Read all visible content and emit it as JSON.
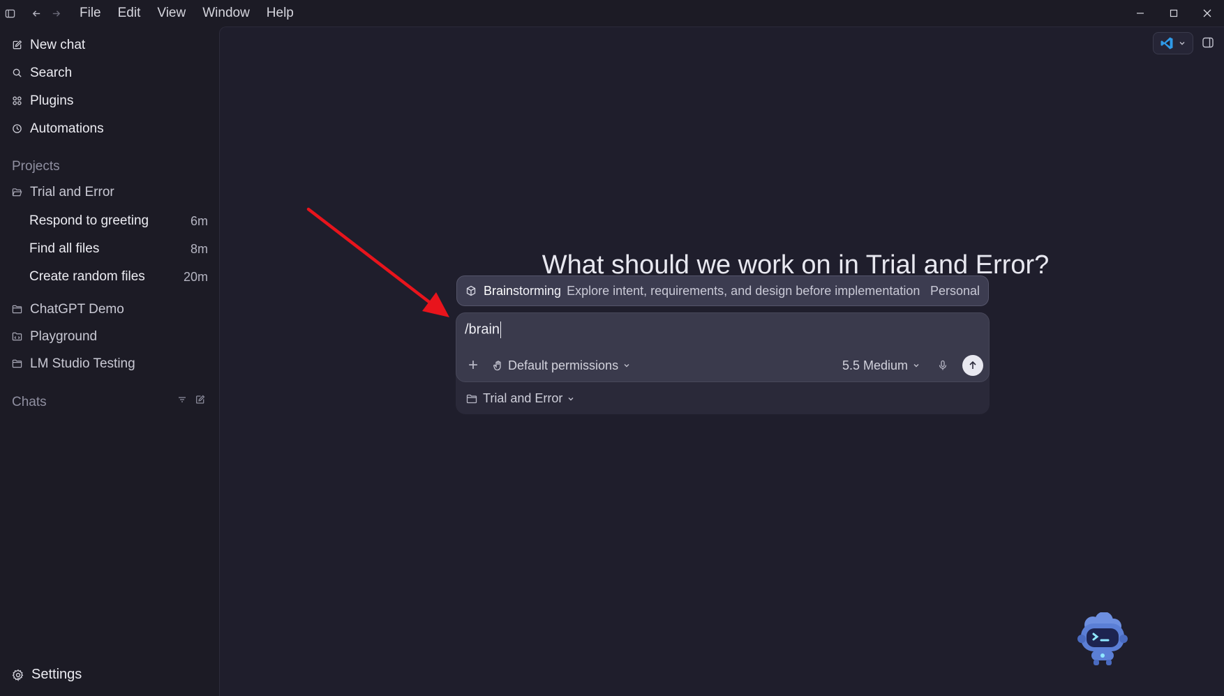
{
  "menu": [
    "File",
    "Edit",
    "View",
    "Window",
    "Help"
  ],
  "sidebar": {
    "nav": [
      {
        "label": "New chat",
        "icon": "edit-icon"
      },
      {
        "label": "Search",
        "icon": "search-icon"
      },
      {
        "label": "Plugins",
        "icon": "grid-icon"
      },
      {
        "label": "Automations",
        "icon": "clock-icon"
      }
    ],
    "projects_label": "Projects",
    "active_project": "Trial and Error",
    "project_chats": [
      {
        "title": "Respond to greeting",
        "time": "6m"
      },
      {
        "title": "Find all files",
        "time": "8m"
      },
      {
        "title": "Create random files",
        "time": "20m"
      }
    ],
    "other_projects": [
      "ChatGPT Demo",
      "Playground",
      "LM Studio Testing"
    ],
    "chats_label": "Chats",
    "settings_label": "Settings"
  },
  "main": {
    "heading": "What should we work on in Trial and Error?",
    "suggestion": {
      "name_match": "Brain",
      "name_rest": "storming",
      "description": "Explore intent, requirements, and design before implementation",
      "tag": "Personal"
    },
    "composer": {
      "input_value": "/brain",
      "permissions_label": "Default permissions",
      "model_label": "5.5 Medium"
    },
    "project_selector": "Trial and Error"
  },
  "colors": {
    "background": "#1c1b25",
    "main_panel": "#1f1e2c",
    "accent_arrow": "#e8141c",
    "vscode_blue": "#2f9ae8",
    "mascot_blue": "#5b7fd6"
  }
}
